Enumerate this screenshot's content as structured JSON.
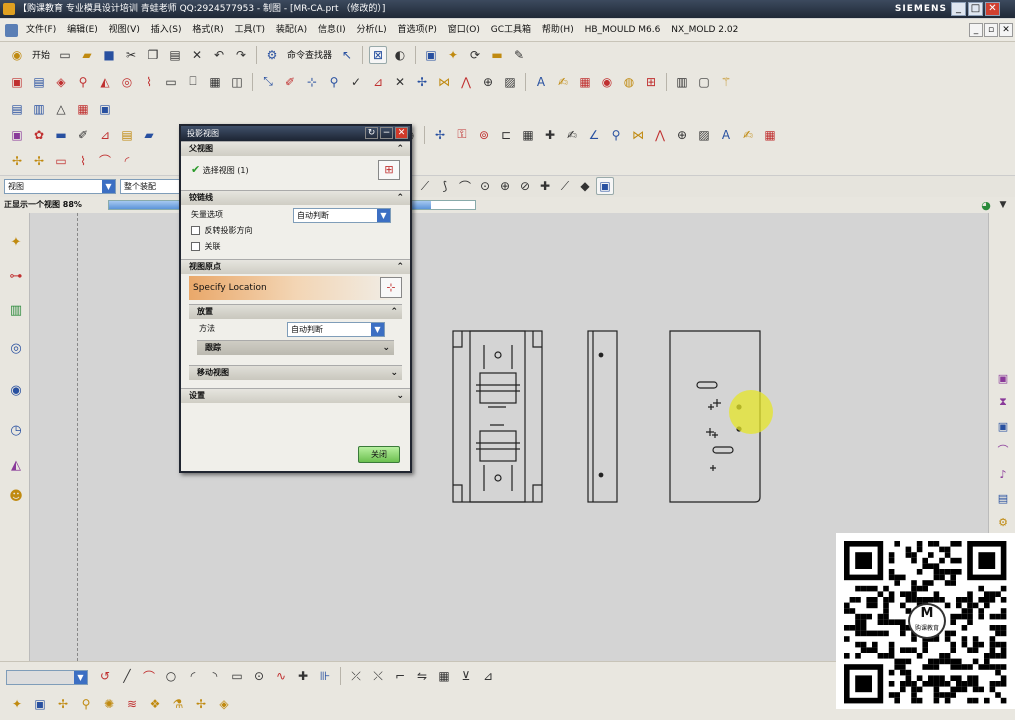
{
  "window": {
    "title": "【购课教育 专业模具设计培训 青蛙老师 QQ:2924577953 - 制图 - [MR-CA.prt （修改的）]",
    "brand": "SIEMENS",
    "min": "_",
    "max": "□",
    "close": "✕"
  },
  "menubar": {
    "items": [
      "文件(F)",
      "编辑(E)",
      "视图(V)",
      "插入(S)",
      "格式(R)",
      "工具(T)",
      "装配(A)",
      "信息(I)",
      "分析(L)",
      "首选项(P)",
      "窗口(O)",
      "GC工具箱",
      "帮助(H)",
      "HB_MOULD M6.6",
      "NX_MOLD 2.02"
    ]
  },
  "toolbar": {
    "start_label": "开始",
    "command_finder_label": "命令查找器"
  },
  "filterbar": {
    "type_filter": "视图",
    "scope_filter": "整个装配"
  },
  "status": {
    "text": "正显示一个视图 88%",
    "progress": 0.88
  },
  "dialog": {
    "title": "投影视图",
    "parent_view_section": "父视图",
    "select_view": "选择视图 (1)",
    "hinge_line_section": "铰链线",
    "vector_option_label": "矢量选项",
    "vector_option_value": "自动判断",
    "reverse_projection": "反转投影方向",
    "associative": "关联",
    "view_origin_section": "视图原点",
    "specify_location": "Specify Location",
    "placement_section": "放置",
    "method_label": "方法",
    "method_value": "自动判断",
    "tracking_section": "跟踪",
    "move_view_section": "移动视图",
    "settings_section": "设置",
    "close_button": "关闭"
  },
  "qr": {
    "caption": "购课教育"
  }
}
